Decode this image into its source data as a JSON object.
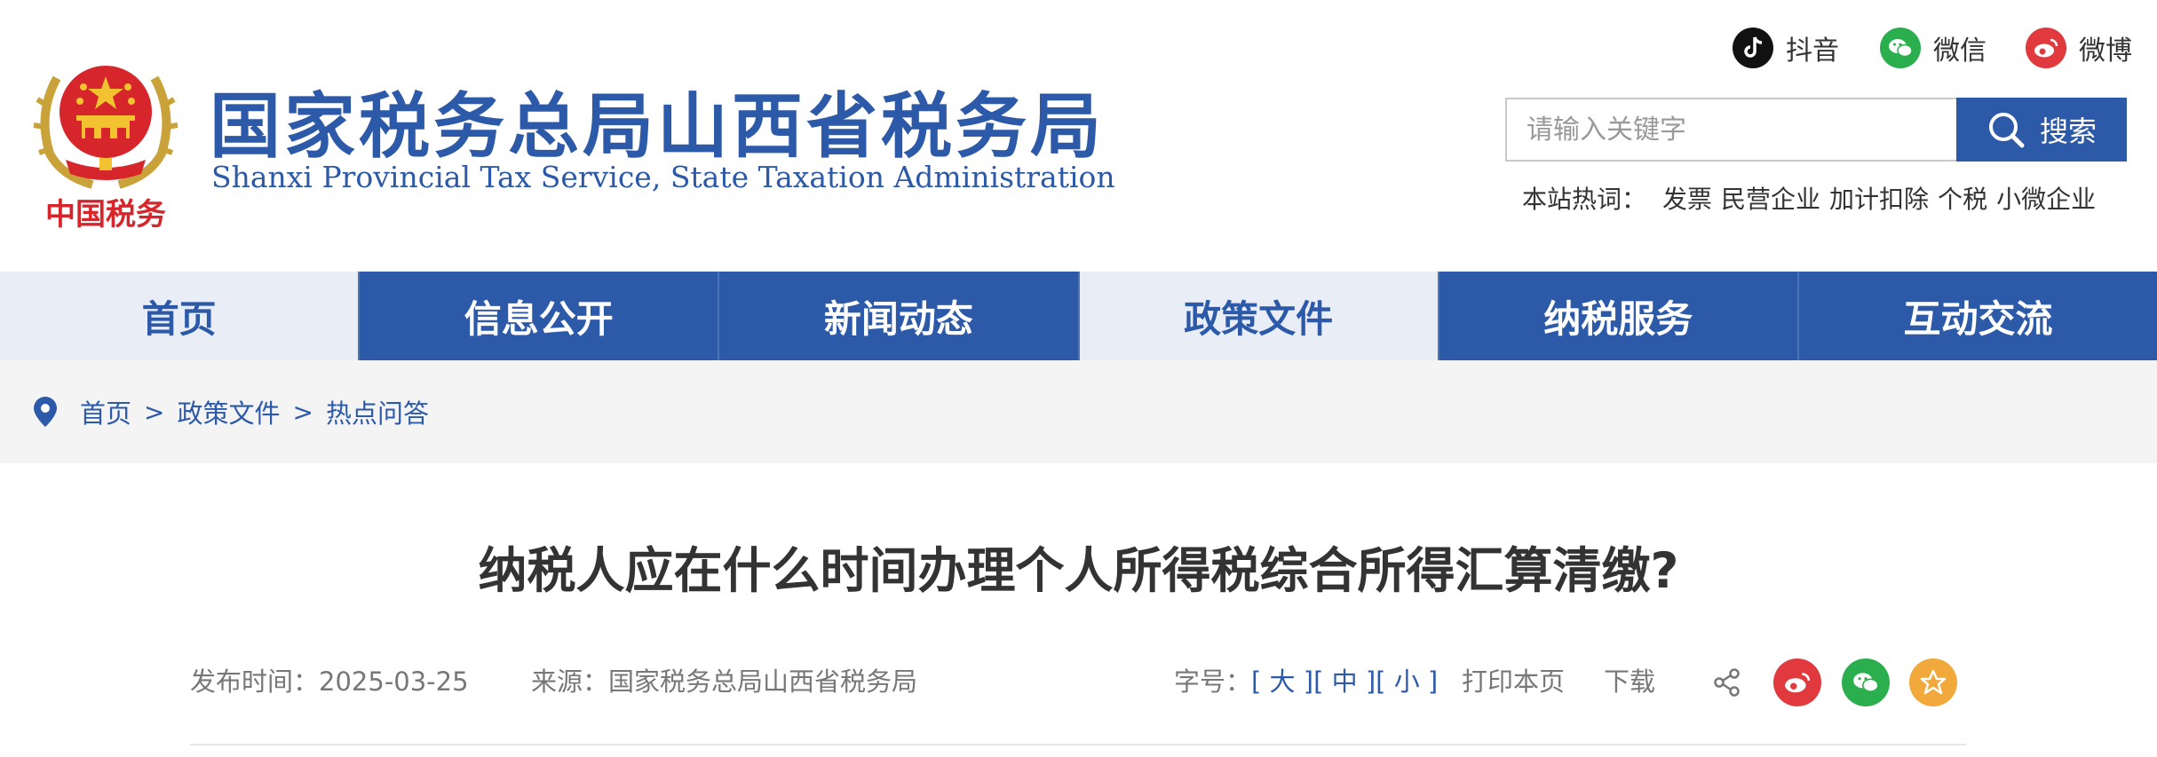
{
  "header": {
    "emblem_text": "中国税务",
    "title": "国家税务总局山西省税务局",
    "subtitle": "Shanxi Provincial Tax Service, State Taxation Administration"
  },
  "social": {
    "douyin": "抖音",
    "wechat": "微信",
    "weibo": "微博"
  },
  "search": {
    "placeholder": "请输入关键字",
    "button": "搜索"
  },
  "hot": {
    "label": "本站热词：",
    "items": [
      "发票",
      "民营企业",
      "加计扣除",
      "个税",
      "小微企业"
    ]
  },
  "nav": {
    "items": [
      "首页",
      "信息公开",
      "新闻动态",
      "政策文件",
      "纳税服务",
      "互动交流"
    ]
  },
  "breadcrumb": {
    "items": [
      "首页",
      "政策文件",
      "热点问答"
    ],
    "separator": ">"
  },
  "article": {
    "title": "纳税人应在什么时间办理个人所得税综合所得汇算清缴?",
    "publish_label": "发布时间：",
    "publish_date": "2025-03-25",
    "source_label": "来源：",
    "source": "国家税务总局山西省税务局",
    "fontsize_label": "字号：",
    "font_large": "[ 大 ]",
    "font_medium": "[ 中 ]",
    "font_small": "[ 小 ]",
    "print": "打印本页",
    "download": "下载"
  },
  "colors": {
    "brand_blue": "#2c59a8",
    "nav_light": "#e9eef6",
    "weibo_red": "#e0393e",
    "wechat_green": "#2aae4e",
    "favorite_orange": "#f0a93a"
  }
}
